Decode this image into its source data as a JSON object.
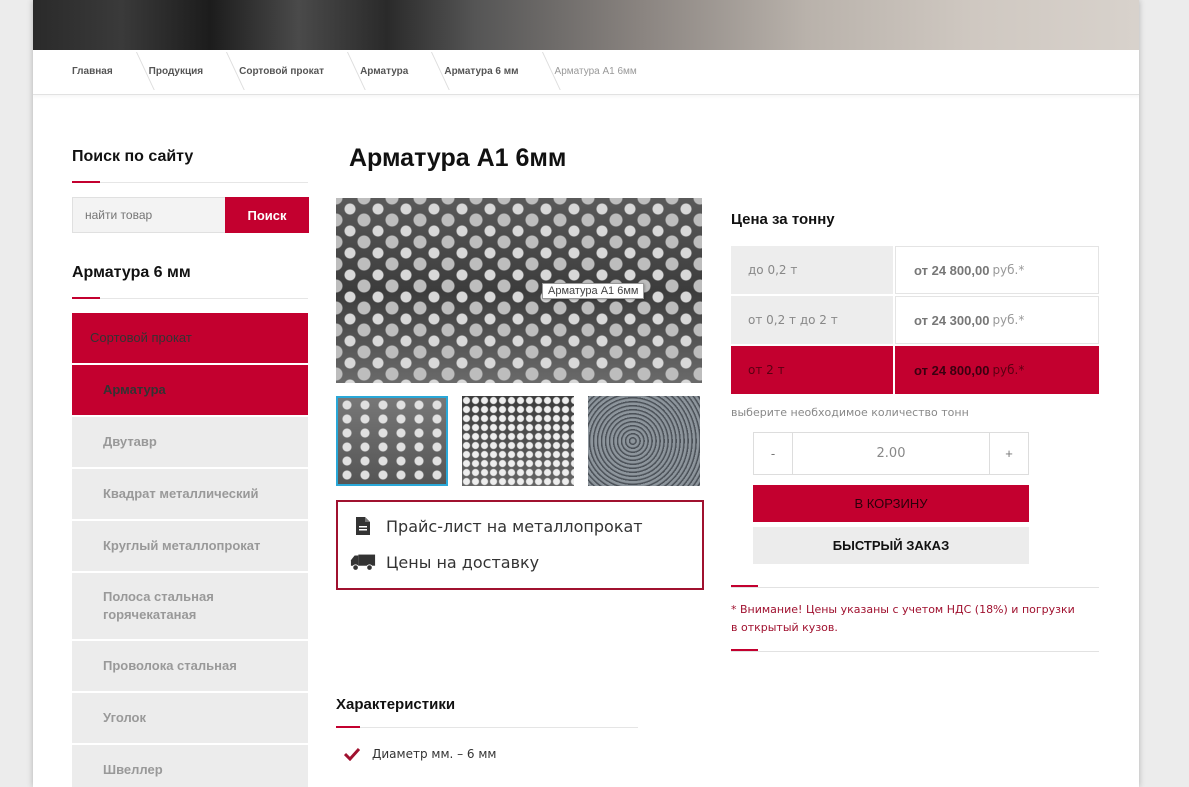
{
  "breadcrumbs": [
    "Главная",
    "Продукция",
    "Сортовой прокат",
    "Арматура",
    "Арматура 6 мм",
    "Арматура А1 6мм"
  ],
  "sidebar": {
    "search_title": "Поиск по сайту",
    "search_placeholder": "найти товар",
    "search_button": "Поиск",
    "category_title": "Арматура 6 мм",
    "menu": [
      {
        "label": "Сортовой прокат"
      },
      {
        "label": "Арматура"
      },
      {
        "label": "Двутавр"
      },
      {
        "label": "Квадрат металлический"
      },
      {
        "label": "Круглый металлопрокат"
      },
      {
        "label": "Полоса стальная горячекатаная"
      },
      {
        "label": "Проволока стальная"
      },
      {
        "label": "Уголок"
      },
      {
        "label": "Швеллер"
      }
    ]
  },
  "product": {
    "title": "Арматура А1 6мм",
    "image_tooltip": "Арматура А1 6мм",
    "links": {
      "price_list": "Прайс-лист на металлопрокат",
      "delivery": "Цены на доставку"
    },
    "characteristics_title": "Характеристики",
    "characteristics": [
      "Диаметр мм. – 6 мм"
    ]
  },
  "pricing": {
    "title": "Цена за тонну",
    "rows": [
      {
        "range": "до 0,2 т",
        "price": "от 24 800,00",
        "unit": "руб.*",
        "selected": false
      },
      {
        "range": "от 0,2 т до 2 т",
        "price": "от 24 300,00",
        "unit": "руб.*",
        "selected": false
      },
      {
        "range": "от 2 т",
        "price": "от 24 800,00",
        "unit": "руб.*",
        "selected": true
      }
    ],
    "quantity_hint": "выберите необходимое количество тонн",
    "minus": "-",
    "plus": "+",
    "quantity": "2.00",
    "add_to_cart": "В КОРЗИНУ",
    "quick_order": "БЫСТРЫЙ ЗАКАЗ",
    "note": "* Внимание! Цены указаны с учетом НДС (18%) и погрузки в открытый кузов."
  },
  "colors": {
    "accent": "#c3002f",
    "border_accent": "#a0112f",
    "thumb_selected": "#2aa8d8"
  }
}
